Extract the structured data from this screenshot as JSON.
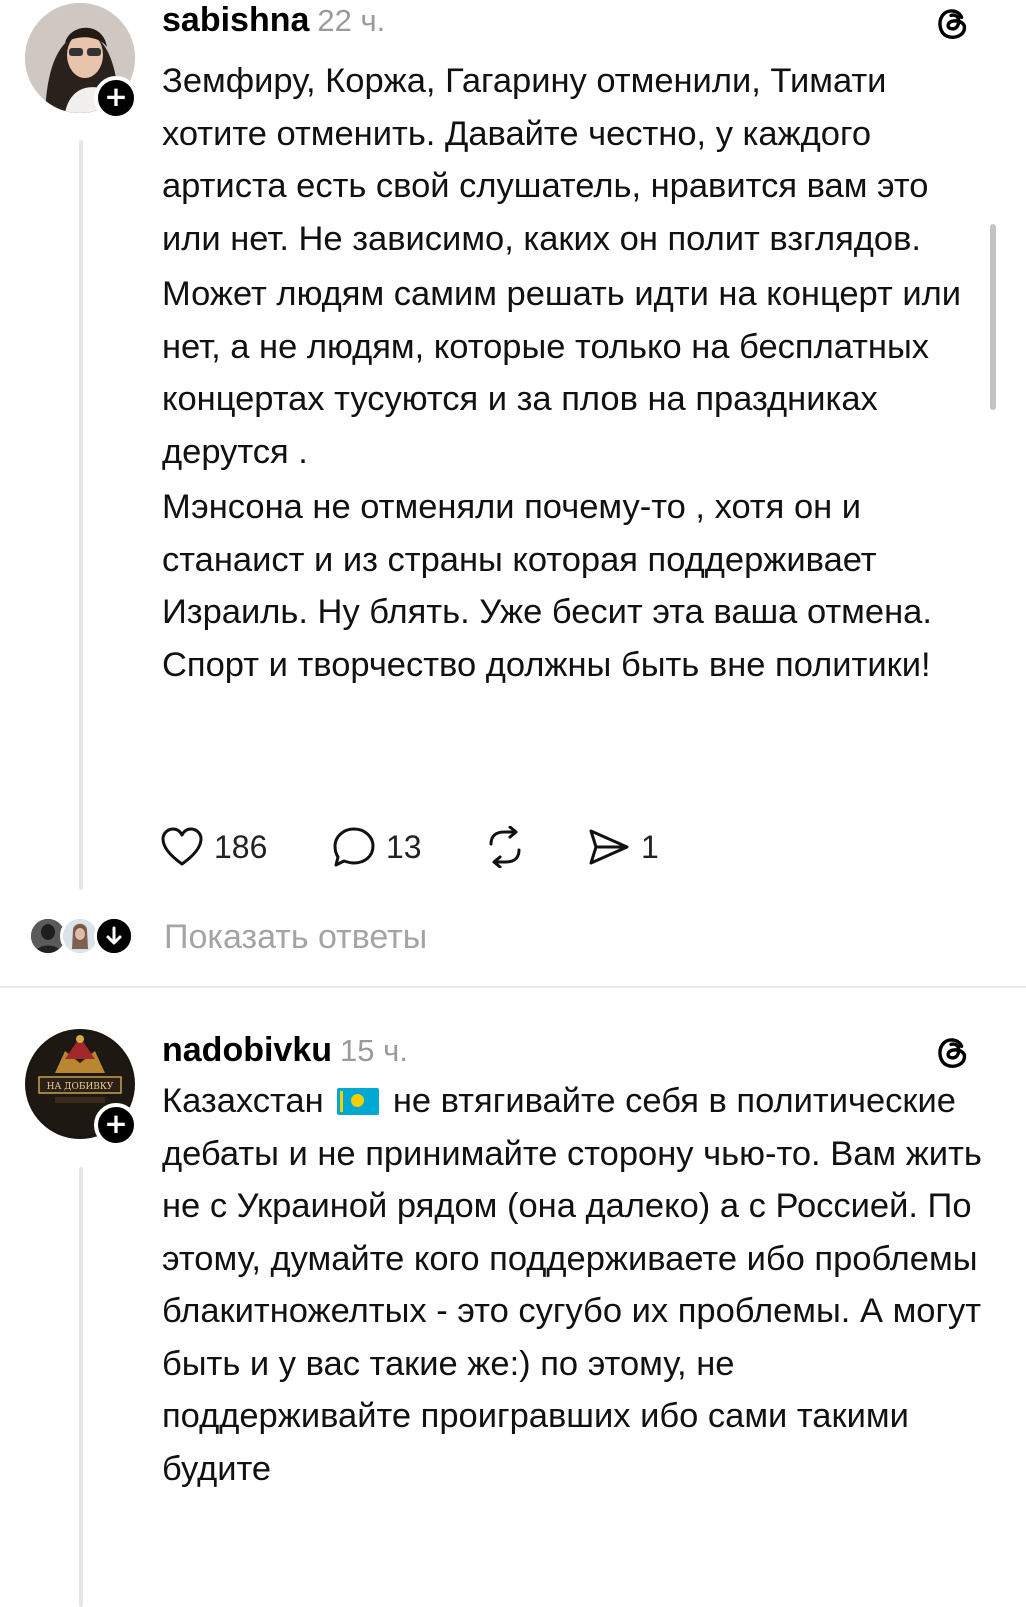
{
  "posts": [
    {
      "username": "sabishna",
      "time": "22 ч.",
      "avatar_icon": "profile-photo-woman-sunglasses",
      "follow_icon": "plus-icon",
      "paragraphs": [
        "Земфиру, Коржа, Гагарину отменили, Тимати хотите отменить. Давайте честно, у каждого артиста есть свой слушатель, нравится вам это или нет. Не зависимо, каких он полит взглядов.",
        "Может людям самим решать идти на концерт или нет, а не людям, которые только на бесплатных концертах тусуются и за плов на праздниках дерутся .",
        "Мэнсона не отменяли почему-то , хотя он и станаист и из страны которая поддерживает Израиль. Ну блять. Уже бесит эта ваша отмена. Спорт и творчество должны быть вне политики!"
      ],
      "actions": {
        "likes": "186",
        "replies": "13",
        "shares": "1"
      },
      "show_replies": "Показать ответы"
    },
    {
      "username": "nadobivku",
      "time": "15 ч.",
      "avatar_icon": "logo-na-dobivku",
      "avatar_text": "НА ДОБИВКУ",
      "follow_icon": "plus-icon",
      "text_before_flag": "Казахстан",
      "flag_icon": "kazakhstan-flag-emoji",
      "text_after_flag": "не втягивайте себя в политические дебаты и не принимайте сторону чью-то. Вам жить не с Украиной рядом (она далеко) а с Россией. По этому, думайте кого поддерживаете ибо проблемы блакитножелтых - это сугубо их проблемы. А могут быть и у вас такие же:) по этому, не поддерживайте проигравших ибо сами такими будите"
    }
  ],
  "colors": {
    "text": "#111111",
    "muted": "#9a9a9a",
    "thread_line": "#e6e6e6",
    "divider": "#e8e8e8"
  }
}
